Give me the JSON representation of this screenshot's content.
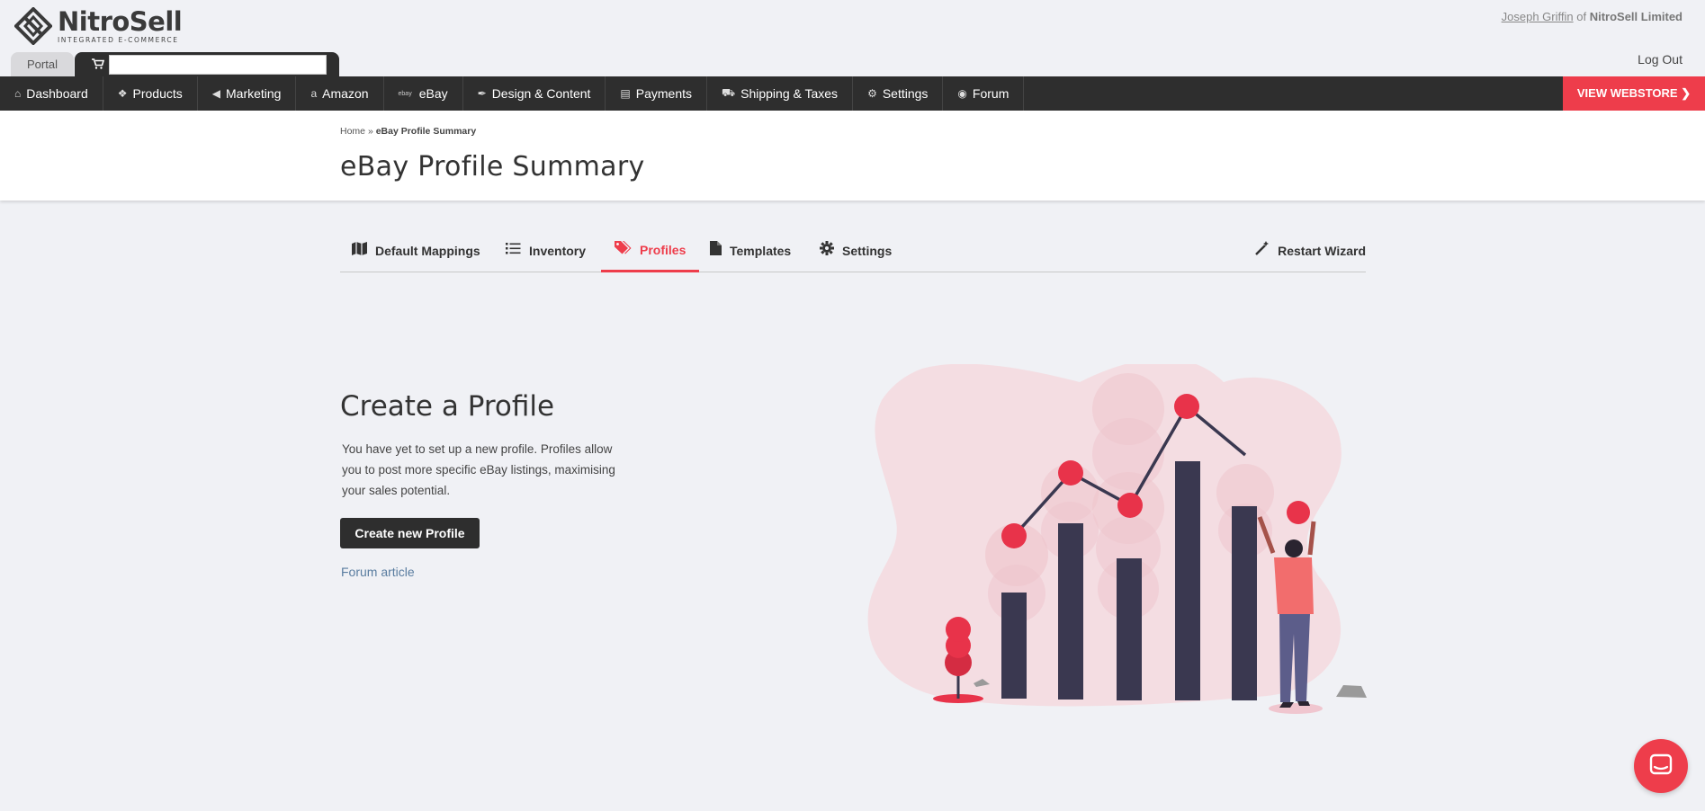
{
  "brand": {
    "name": "NitroSell",
    "tagline": "INTEGRATED E-COMMERCE"
  },
  "user": {
    "name": "Joseph Griffin",
    "of": "of",
    "company": "NitroSell Limited",
    "logout": "Log Out"
  },
  "tabs": {
    "portal": "Portal",
    "cart_input_value": ""
  },
  "nav": {
    "items": [
      {
        "label": "Dashboard",
        "icon": "home-icon"
      },
      {
        "label": "Products",
        "icon": "cubes-icon"
      },
      {
        "label": "Marketing",
        "icon": "bullhorn-icon"
      },
      {
        "label": "Amazon",
        "icon": "amazon-icon"
      },
      {
        "label": "eBay",
        "icon": "ebay-icon",
        "mini": "ebay"
      },
      {
        "label": "Design & Content",
        "icon": "paintbrush-icon"
      },
      {
        "label": "Payments",
        "icon": "money-icon"
      },
      {
        "label": "Shipping & Taxes",
        "icon": "truck-icon"
      },
      {
        "label": "Settings",
        "icon": "gear-icon"
      },
      {
        "label": "Forum",
        "icon": "comment-icon"
      }
    ],
    "view_webstore": "VIEW WEBSTORE ❯"
  },
  "breadcrumb": {
    "home": "Home",
    "sep": "»",
    "current": "eBay Profile Summary"
  },
  "page_title": "eBay Profile Summary",
  "subtabs": [
    {
      "label": "Default Mappings",
      "icon": "map-icon"
    },
    {
      "label": "Inventory",
      "icon": "list-icon"
    },
    {
      "label": "Profiles",
      "icon": "tags-icon",
      "active": true
    },
    {
      "label": "Templates",
      "icon": "file-icon"
    },
    {
      "label": "Settings",
      "icon": "gear-icon"
    },
    {
      "label": "Restart Wizard",
      "icon": "magic-wand-icon"
    }
  ],
  "main": {
    "title": "Create a Profile",
    "description": "You have yet to set up a new profile. Profiles allow you to post more specific eBay listings, maximising your sales potential.",
    "create_button": "Create new Profile",
    "forum_link": "Forum article"
  },
  "colors": {
    "accent": "#ee3d4b",
    "dark": "#2e2e2e",
    "background": "#f0f1f5"
  }
}
